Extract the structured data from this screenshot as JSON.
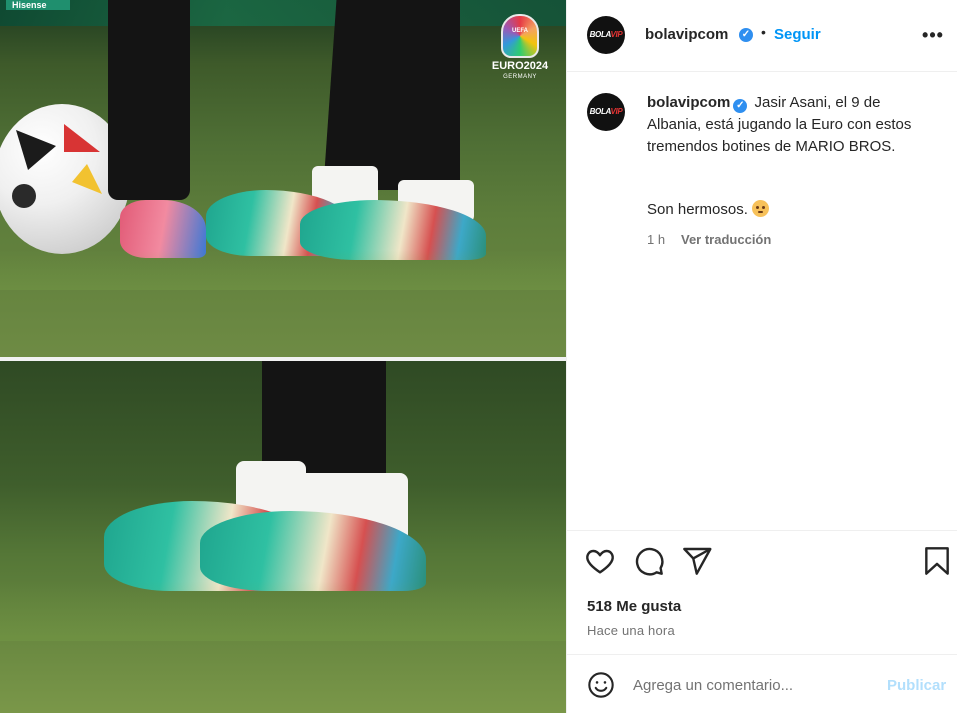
{
  "media": {
    "ad_brand": "Hisense",
    "tournament": {
      "uefa": "UEFA",
      "name": "EURO2024",
      "host": "GERMANY"
    }
  },
  "header": {
    "avatar_text_a": "BOLA",
    "avatar_text_b": "VIP",
    "username": "bolavipcom",
    "separator": "•",
    "follow_label": "Seguir",
    "more_label": "•••"
  },
  "caption": {
    "username": "bolavipcom",
    "text": "Jasir Asani, el 9 de Albania, está jugando la Euro con estos tremendos botines de MARIO BROS.",
    "second_line": "Son hermosos.",
    "time_ago": "1 h",
    "translate_label": "Ver traducción"
  },
  "actions": {
    "likes": "518 Me gusta",
    "posted": "Hace una hora"
  },
  "comment": {
    "placeholder": "Agrega un comentario...",
    "publish_label": "Publicar"
  },
  "colors": {
    "accent": "#0095f6",
    "verified": "#2f8ff0",
    "publish_disabled": "#b2dffc",
    "muted_text": "#737373"
  },
  "icons": [
    "heart-icon",
    "comment-icon",
    "share-icon",
    "bookmark-icon",
    "more-icon",
    "verified-icon",
    "emoji-icon"
  ]
}
